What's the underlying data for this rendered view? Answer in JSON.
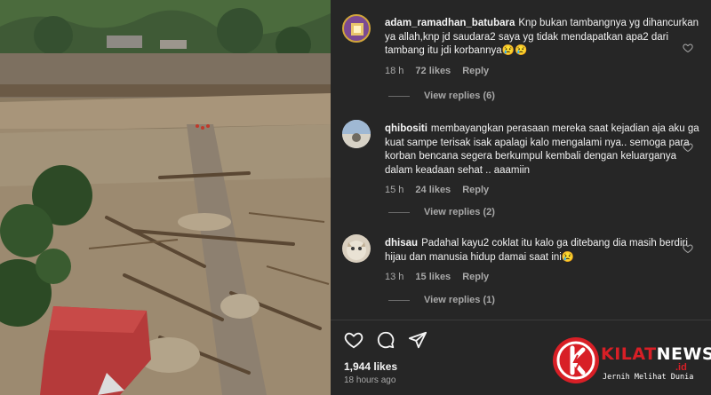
{
  "comments": [
    {
      "username": "adam_ramadhan_batubara",
      "text": "Knp bukan tambangnya yg dihancurkan ya allah,knp jd saudara2 saya yg tidak mendapatkan apa2 dari tambang itu jdi korbannya😢😢",
      "time": "18 h",
      "likes": "72 likes",
      "reply_label": "Reply",
      "view_replies": "View replies (6)"
    },
    {
      "username": "qhibositi",
      "text": "membayangkan perasaan mereka saat kejadian aja aku ga kuat sampe terisak isak apalagi kalo mengalami nya.. semoga para korban bencana segera berkumpul kembali dengan keluarganya dalam keadaan sehat .. aaamiin",
      "time": "15 h",
      "likes": "24 likes",
      "reply_label": "Reply",
      "view_replies": "View replies (2)"
    },
    {
      "username": "dhisau",
      "text": "Padahal kayu2 coklat itu kalo ga ditebang dia masih berdiri hijau dan manusia hidup damai saat ini😢",
      "time": "13 h",
      "likes": "15 likes",
      "reply_label": "Reply",
      "view_replies": "View replies (1)"
    }
  ],
  "post": {
    "likes": "1,944 likes",
    "posted": "18 hours ago"
  },
  "watermark": {
    "name_part1": "KILAT",
    "name_part2": "NEWS",
    "tld": ".id",
    "tagline": "Jernih Melihat Dunia"
  },
  "icons": [
    "heart-icon",
    "comment-icon",
    "share-icon",
    "small-heart-icon"
  ],
  "colors": {
    "panel_bg": "#262626",
    "text_primary": "#f5f5f5",
    "text_secondary": "#a8a8a8",
    "brand_red": "#d81f26"
  }
}
